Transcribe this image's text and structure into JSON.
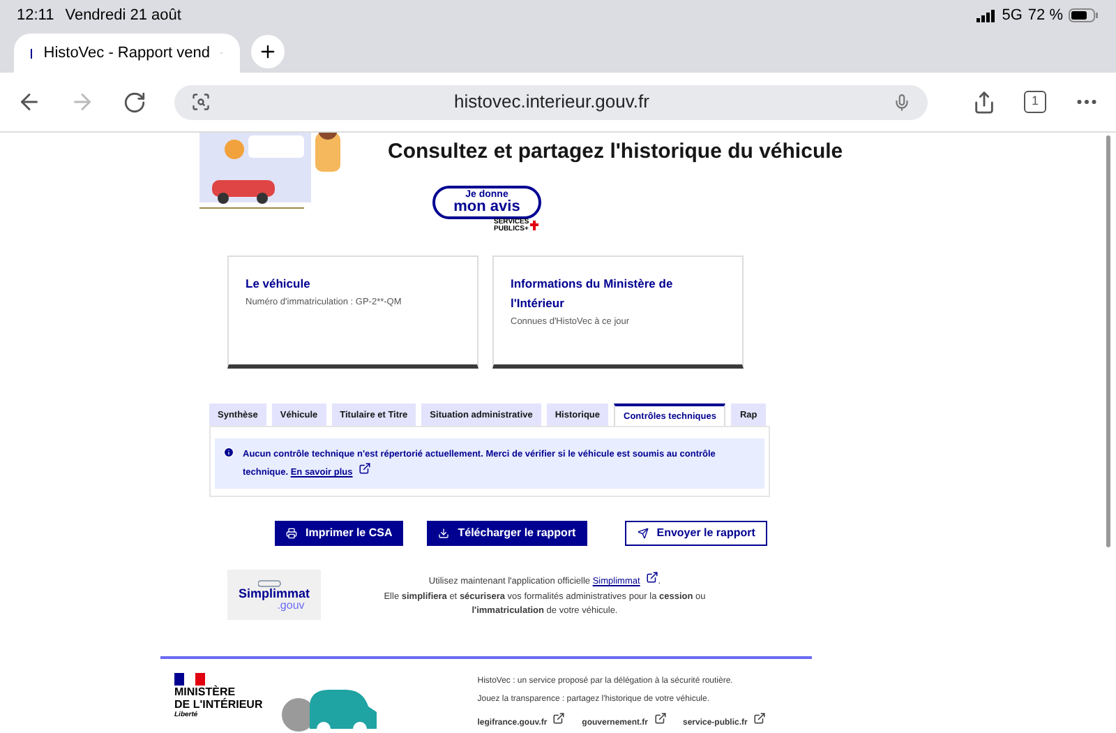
{
  "status_bar": {
    "time": "12:11",
    "date": "Vendredi 21 août",
    "network": "5G",
    "battery": "72 %"
  },
  "browser": {
    "tab_title": "HistoVec - Rapport vend",
    "tab_count": "1",
    "url": "histovec.interieur.gouv.fr"
  },
  "hero": {
    "title": "Consultez et partagez l'historique du véhicule",
    "feedback_button": [
      "Je donne",
      "mon avis"
    ],
    "feedback_brand": [
      "SERVICES",
      "PUBLICS+"
    ]
  },
  "cards": [
    {
      "title": "Le véhicule",
      "text": "Numéro d'immatriculation : GP-2**-QM"
    },
    {
      "title": "Informations du Ministère de l'Intérieur",
      "text": "Connues d'HistoVec à ce jour"
    }
  ],
  "tabs": [
    {
      "label": "Synthèse",
      "selected": false
    },
    {
      "label": "Véhicule",
      "selected": false
    },
    {
      "label": "Titulaire et Titre",
      "selected": false
    },
    {
      "label": "Situation administrative",
      "selected": false
    },
    {
      "label": "Historique",
      "selected": false
    },
    {
      "label": "Contrôles techniques",
      "selected": true
    },
    {
      "label": "Rap",
      "selected": false
    }
  ],
  "notice": {
    "text": "Aucun contrôle technique n'est répertorié actuellement. Merci de vérifier si le véhicule est soumis au contrôle technique.",
    "link": "En savoir plus"
  },
  "actions": [
    {
      "label": "Imprimer le CSA",
      "kind": "primary"
    },
    {
      "label": "Télécharger le rapport",
      "kind": "primary"
    },
    {
      "label": "Envoyer le rapport",
      "kind": "secondary"
    }
  ],
  "promo": {
    "logo": [
      "Simplimmat",
      ".gouv"
    ],
    "lead": "Utilisez maintenant l'application officielle",
    "link": "Simplimmat",
    "link_end": ".",
    "rest": "Elle **simplifiera** et **sécurisera** vos formalités administratives pour la **cession** ou **l'immatriculation** de votre véhicule."
  },
  "footer": {
    "ministry": [
      "MINISTÈRE",
      "DE L'INTÉRIEUR"
    ],
    "motto": "Liberté",
    "description": [
      "HistoVec : un service proposé par la délégation à la sécurité routière.",
      "Jouez la transparence : partagez l'historique de votre véhicule."
    ],
    "links": [
      "legifrance.gouv.fr",
      "gouvernement.fr",
      "service-public.fr"
    ]
  }
}
